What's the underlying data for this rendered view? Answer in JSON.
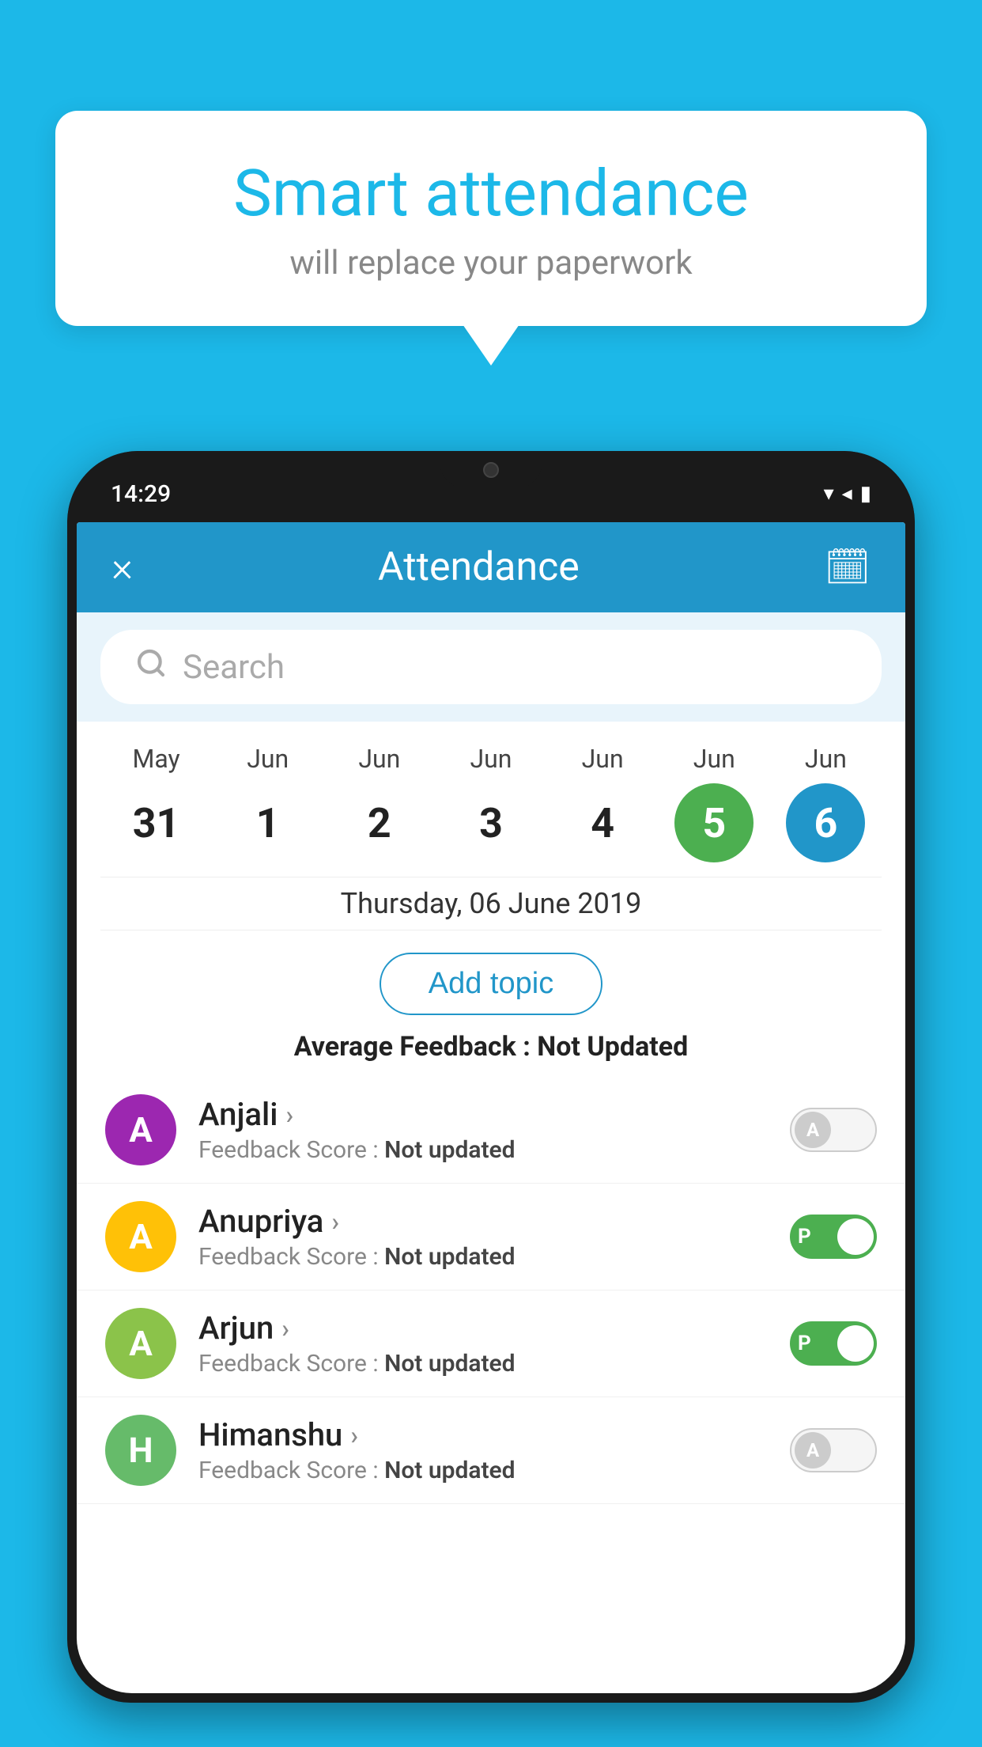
{
  "background": {
    "color": "#1cb8e8"
  },
  "speech_bubble": {
    "title": "Smart attendance",
    "subtitle": "will replace your paperwork"
  },
  "status_bar": {
    "time": "14:29",
    "wifi_icon": "▼",
    "signal_icon": "▲",
    "battery_icon": "▮"
  },
  "app_header": {
    "close_icon": "×",
    "title": "Attendance",
    "calendar_icon": "📅"
  },
  "search": {
    "placeholder": "Search"
  },
  "date_picker": {
    "dates": [
      {
        "month": "May",
        "day": "31",
        "state": "normal"
      },
      {
        "month": "Jun",
        "day": "1",
        "state": "normal"
      },
      {
        "month": "Jun",
        "day": "2",
        "state": "normal"
      },
      {
        "month": "Jun",
        "day": "3",
        "state": "normal"
      },
      {
        "month": "Jun",
        "day": "4",
        "state": "normal"
      },
      {
        "month": "Jun",
        "day": "5",
        "state": "today"
      },
      {
        "month": "Jun",
        "day": "6",
        "state": "selected"
      }
    ]
  },
  "selected_date_label": "Thursday, 06 June 2019",
  "add_topic_label": "Add topic",
  "average_feedback": {
    "label": "Average Feedback :",
    "value": "Not Updated"
  },
  "students": [
    {
      "name": "Anjali",
      "avatar_letter": "A",
      "avatar_color": "purple",
      "feedback_label": "Feedback Score :",
      "feedback_value": "Not updated",
      "toggle_state": "off",
      "toggle_label": "A"
    },
    {
      "name": "Anupriya",
      "avatar_letter": "A",
      "avatar_color": "yellow",
      "feedback_label": "Feedback Score :",
      "feedback_value": "Not updated",
      "toggle_state": "on",
      "toggle_label": "P"
    },
    {
      "name": "Arjun",
      "avatar_letter": "A",
      "avatar_color": "green-light",
      "feedback_label": "Feedback Score :",
      "feedback_value": "Not updated",
      "toggle_state": "on",
      "toggle_label": "P"
    },
    {
      "name": "Himanshu",
      "avatar_letter": "H",
      "avatar_color": "green-dark",
      "feedback_label": "Feedback Score :",
      "feedback_value": "Not updated",
      "toggle_state": "off",
      "toggle_label": "A"
    }
  ]
}
